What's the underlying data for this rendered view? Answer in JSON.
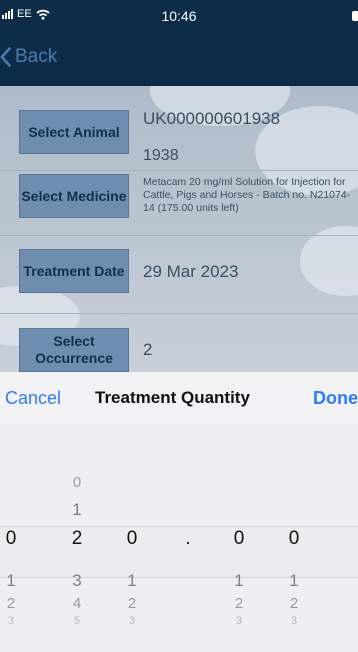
{
  "status_bar": {
    "carrier": "EE",
    "time": "10:46"
  },
  "nav": {
    "back_label": "Back"
  },
  "form": {
    "animal": {
      "button": "Select Animal",
      "value_line1": "UK000000601938",
      "value_line2": "1938"
    },
    "medicine": {
      "button": "Select Medicine",
      "value": "Metacam 20 mg/ml Solution for Injection for Cattle, Pigs and Horses - Batch no. N21074-14 (175.00 units left)"
    },
    "treatment_date": {
      "button": "Treatment Date",
      "value": "29 Mar 2023"
    },
    "occurrence": {
      "button": "Select Occurrence",
      "value": "2"
    }
  },
  "picker_sheet": {
    "cancel_label": "Cancel",
    "title": "Treatment Quantity",
    "done_label": "Done",
    "columns": [
      {
        "above": [],
        "selected": "0",
        "below": [
          "1",
          "2",
          "3"
        ]
      },
      {
        "above": [
          "0",
          "1"
        ],
        "selected": "2",
        "below": [
          "3",
          "4",
          "5"
        ]
      },
      {
        "above": [],
        "selected": "0",
        "below": [
          "1",
          "2",
          "3"
        ]
      },
      {
        "above": [],
        "selected": ".",
        "below": []
      },
      {
        "above": [],
        "selected": "0",
        "below": [
          "1",
          "2",
          "3"
        ]
      },
      {
        "above": [],
        "selected": "0",
        "below": [
          "1",
          "2",
          "3"
        ]
      }
    ]
  },
  "colors": {
    "nav_background": "#0e2c47",
    "accent_blue": "#2f7cf6",
    "select_button": "#6f8dae"
  }
}
